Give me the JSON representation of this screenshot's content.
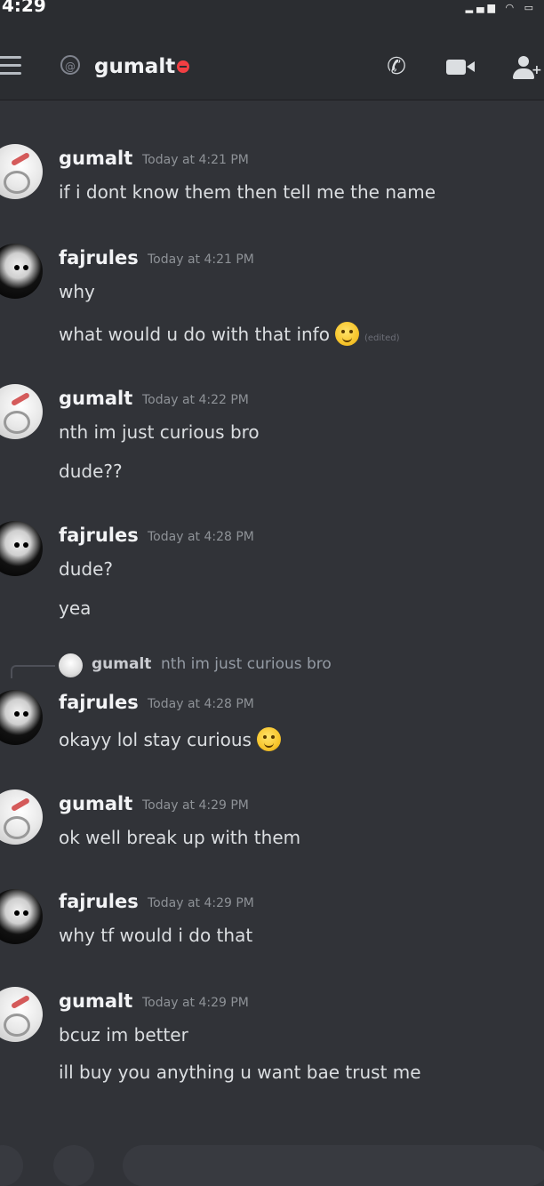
{
  "status_bar": {
    "time": "4:29",
    "indicators": "signal wifi battery"
  },
  "header": {
    "menu_icon": "hamburger-icon",
    "channel_icon": "dm-icon",
    "title": "gumalt",
    "status": "do-not-disturb",
    "status_color": "#f23f43",
    "actions": [
      "call-icon",
      "video-icon",
      "add-members-icon"
    ]
  },
  "messages": [
    {
      "author": "gumalt",
      "timestamp": "Today at 4:21 PM",
      "avatar": "gumalt-avatar",
      "lines": [
        "if i dont know them then tell me the name"
      ]
    },
    {
      "author": "fajrules",
      "timestamp": "Today at 4:21 PM",
      "avatar": "fajrules-avatar",
      "lines": [
        "why",
        "what would u do with that info"
      ],
      "edited_label": "(edited)"
    },
    {
      "author": "gumalt",
      "timestamp": "Today at 4:22 PM",
      "avatar": "gumalt-avatar",
      "lines": [
        "nth im just curious bro",
        "dude??"
      ]
    },
    {
      "author": "fajrules",
      "timestamp": "Today at 4:28 PM",
      "avatar": "fajrules-avatar",
      "lines": [
        "dude?",
        "yea"
      ]
    },
    {
      "author": "fajrules",
      "timestamp": "Today at 4:28 PM",
      "avatar": "fajrules-avatar",
      "reply_to": {
        "author": "gumalt",
        "text": "nth im just curious bro"
      },
      "lines": [
        "okayy lol stay curious"
      ]
    },
    {
      "author": "gumalt",
      "timestamp": "Today at 4:29 PM",
      "avatar": "gumalt-avatar",
      "lines": [
        "ok well break up with them"
      ]
    },
    {
      "author": "fajrules",
      "timestamp": "Today at 4:29 PM",
      "avatar": "fajrules-avatar",
      "lines": [
        "why tf would i do that"
      ]
    },
    {
      "author": "gumalt",
      "timestamp": "Today at 4:29 PM",
      "avatar": "gumalt-avatar",
      "lines": [
        "bcuz im better",
        "ill buy you anything u want bae trust me"
      ]
    }
  ]
}
